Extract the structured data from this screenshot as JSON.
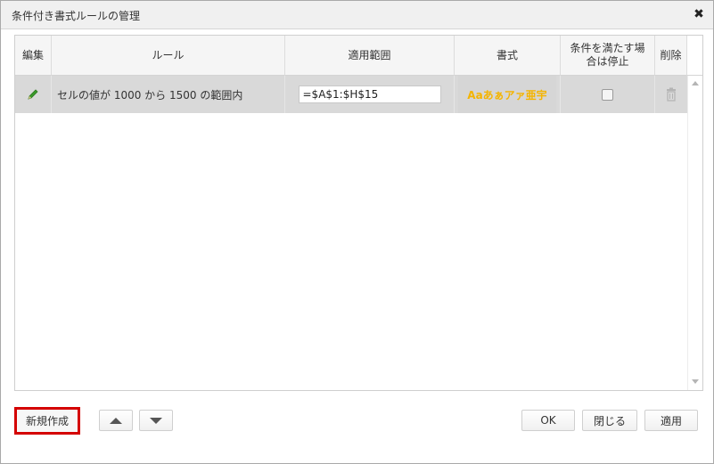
{
  "dialog": {
    "title": "条件付き書式ルールの管理",
    "close_icon": "close-icon"
  },
  "grid": {
    "headers": {
      "edit": "編集",
      "rule": "ルール",
      "range": "適用範囲",
      "format": "書式",
      "stop_line1": "条件を満たす場",
      "stop_line2": "合は停止",
      "delete": "削除"
    },
    "rows": [
      {
        "edit_icon": "pencil-icon",
        "rule": "セルの値が 1000 から 1500 の範囲内",
        "range": "=$A$1:$H$15",
        "format_preview": "Aaあぁアァ亜宇",
        "format_color": "#f4b400",
        "stop_if_true": false,
        "delete_icon": "trash-icon"
      }
    ],
    "selected_row_color": "#d9d9d9"
  },
  "footer": {
    "new_label": "新規作成",
    "move_up_icon": "triangle-up-icon",
    "move_down_icon": "triangle-down-icon",
    "ok_label": "OK",
    "close_label": "閉じる",
    "apply_label": "適用",
    "highlight_color": "#d40000"
  }
}
